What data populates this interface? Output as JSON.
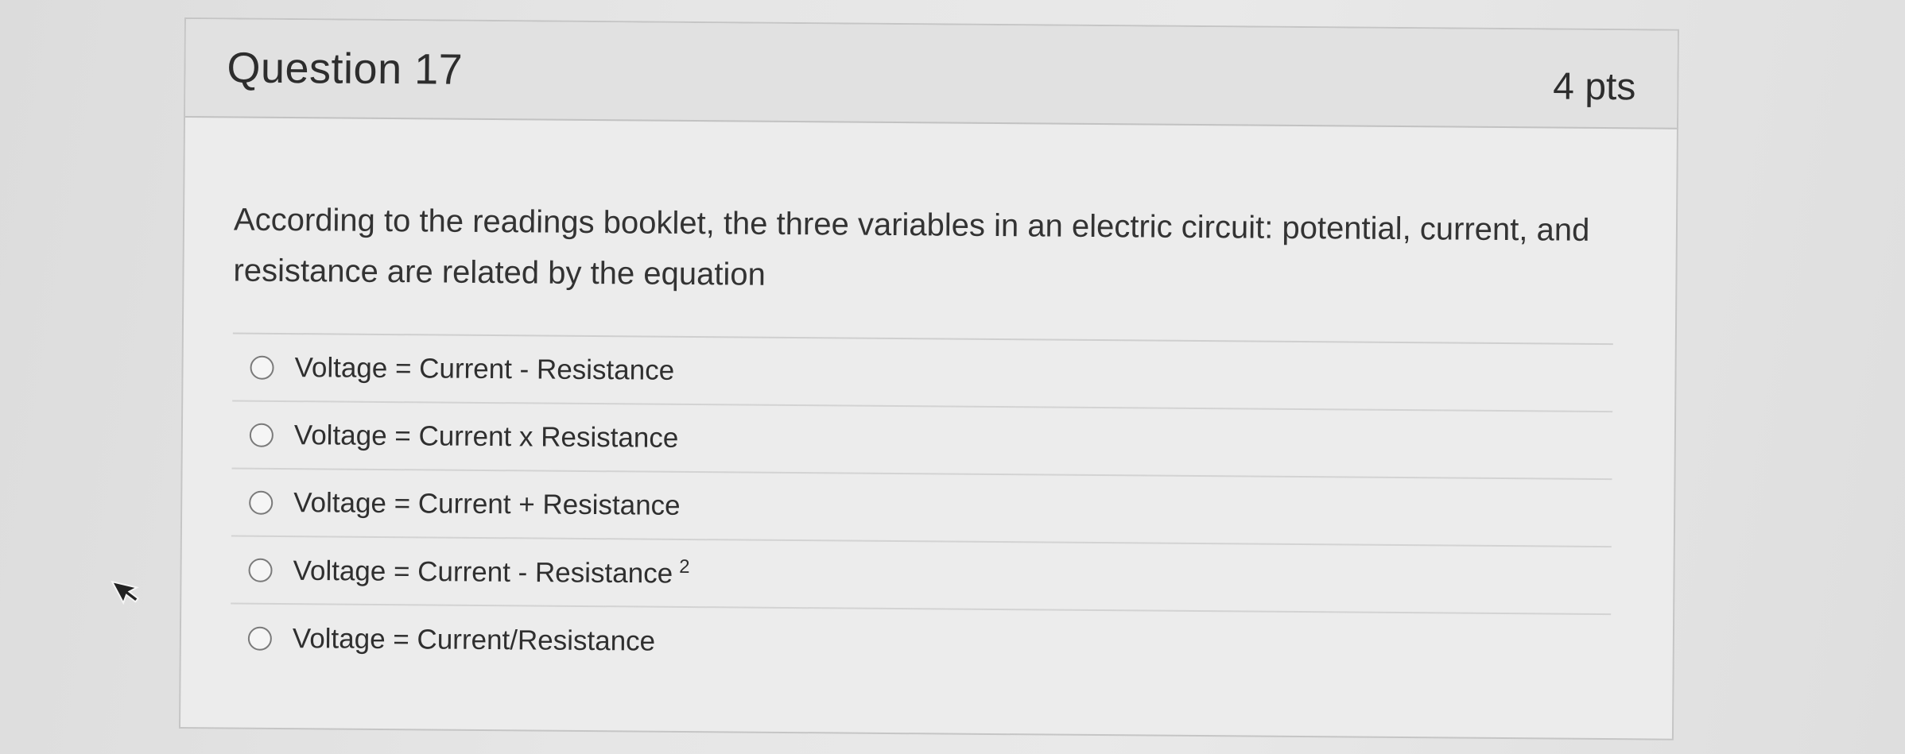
{
  "question": {
    "title": "Question 17",
    "points": "4 pts",
    "text": "According to the readings booklet, the three variables in an electric circuit: potential, current, and resistance are related by the equation"
  },
  "answers": [
    {
      "label": "Voltage = Current - Resistance",
      "superscript": ""
    },
    {
      "label": "Voltage = Current x Resistance",
      "superscript": ""
    },
    {
      "label": "Voltage = Current + Resistance",
      "superscript": ""
    },
    {
      "label": "Voltage = Current - Resistance",
      "superscript": "2"
    },
    {
      "label": "Voltage = Current/Resistance",
      "superscript": ""
    }
  ],
  "icons": {
    "radio": "radio-button-unselected-icon",
    "cursor": "mouse-pointer-icon"
  },
  "colors": {
    "header_bg": "#e1e1e1",
    "card_bg": "#ececec",
    "border": "#c5c5c5",
    "text": "#2d2d2d"
  }
}
